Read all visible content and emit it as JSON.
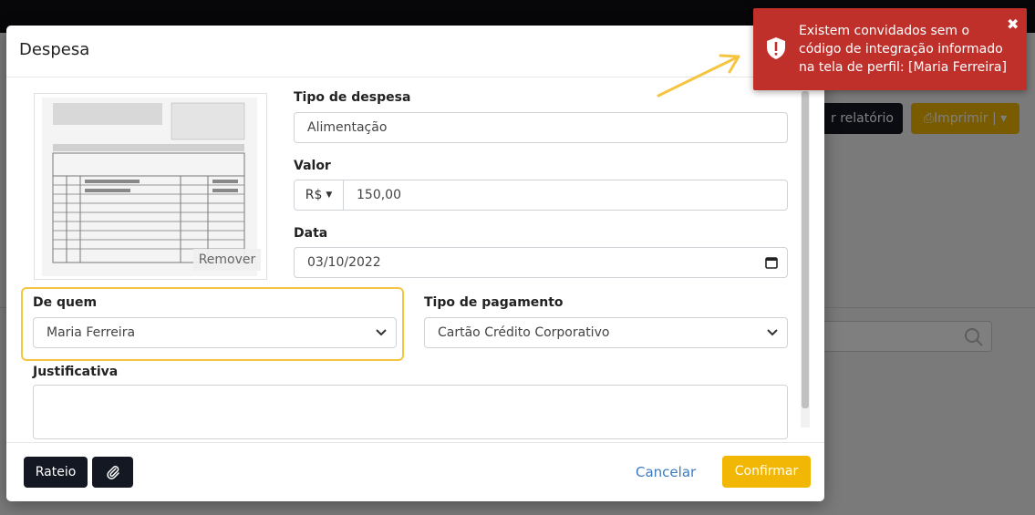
{
  "background": {
    "gerar_label": "r relatório",
    "imprimir_label": "⎙Imprimir | ▾"
  },
  "modal": {
    "title": "Despesa",
    "receipt": {
      "remove_label": "Remover"
    },
    "tipo_despesa": {
      "label": "Tipo de despesa",
      "value": "Alimentação"
    },
    "valor": {
      "label": "Valor",
      "currency": "R$",
      "value": "150,00"
    },
    "data": {
      "label": "Data",
      "value": "03/10/2022"
    },
    "de_quem": {
      "label": "De quem",
      "value": "Maria Ferreira"
    },
    "tipo_pagamento": {
      "label": "Tipo de pagamento",
      "value": "Cartão Crédito Corporativo"
    },
    "justificativa": {
      "label": "Justificativa",
      "value": ""
    },
    "footer": {
      "rateio_label": "Rateio",
      "cancel_label": "Cancelar",
      "confirm_label": "Confirmar"
    }
  },
  "toast": {
    "message": "Existem convidados sem o código de integração informado na tela de perfil: [Maria Ferreira]",
    "close": "✖"
  },
  "colors": {
    "accent": "#f2b705",
    "dark_button": "#141823",
    "toast_bg": "#c0302b",
    "highlight": "#f5c542"
  },
  "icons": {
    "toast": "shield-alert-icon",
    "attach": "paperclip-icon",
    "calendar": "calendar-icon",
    "search": "search-icon"
  }
}
